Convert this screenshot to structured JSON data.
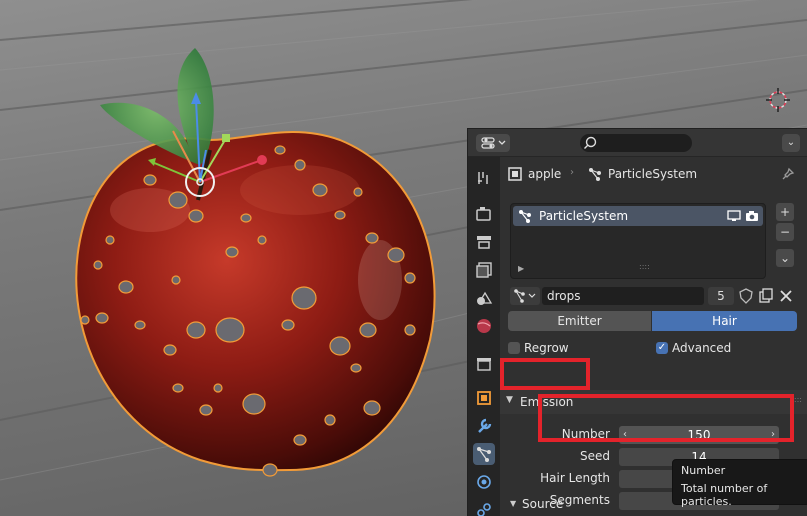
{
  "header": {
    "search_placeholder": ""
  },
  "breadcrumb": {
    "object": "apple",
    "particles": "ParticleSystem"
  },
  "particle_list": {
    "items": [
      {
        "label": "ParticleSystem"
      }
    ],
    "side_buttons": [
      "+",
      "−",
      "⌄"
    ]
  },
  "particle_settings": {
    "name": "drops",
    "user_count": "5"
  },
  "type_toggle": {
    "options": [
      "Emitter",
      "Hair"
    ],
    "selected": "Hair"
  },
  "options": {
    "regrow": {
      "label": "Regrow",
      "checked": false
    },
    "advanced": {
      "label": "Advanced",
      "checked": true
    }
  },
  "emission": {
    "title": "Emission",
    "number": {
      "label": "Number",
      "value": "150"
    },
    "seed": {
      "label": "Seed",
      "value": "14"
    },
    "hair_length": {
      "label": "Hair Length"
    },
    "segments": {
      "label": "Segments"
    }
  },
  "source": {
    "title": "Source"
  },
  "tooltip": {
    "title": "Number",
    "text": "Total number of particles."
  },
  "colors": {
    "accent": "#4772b3",
    "highlight": "#e4232b",
    "selection": "#f29b38"
  },
  "icons": [
    "editor-type-icon",
    "search-icon",
    "chevron-down-icon",
    "tool-icon",
    "render-icon",
    "output-icon",
    "view-layer-icon",
    "scene-icon",
    "world-icon",
    "collection-icon",
    "object-icon",
    "modifier-icon",
    "particles-icon",
    "physics-icon",
    "constraints-icon",
    "pin-icon",
    "monitor-icon",
    "camera-icon"
  ]
}
